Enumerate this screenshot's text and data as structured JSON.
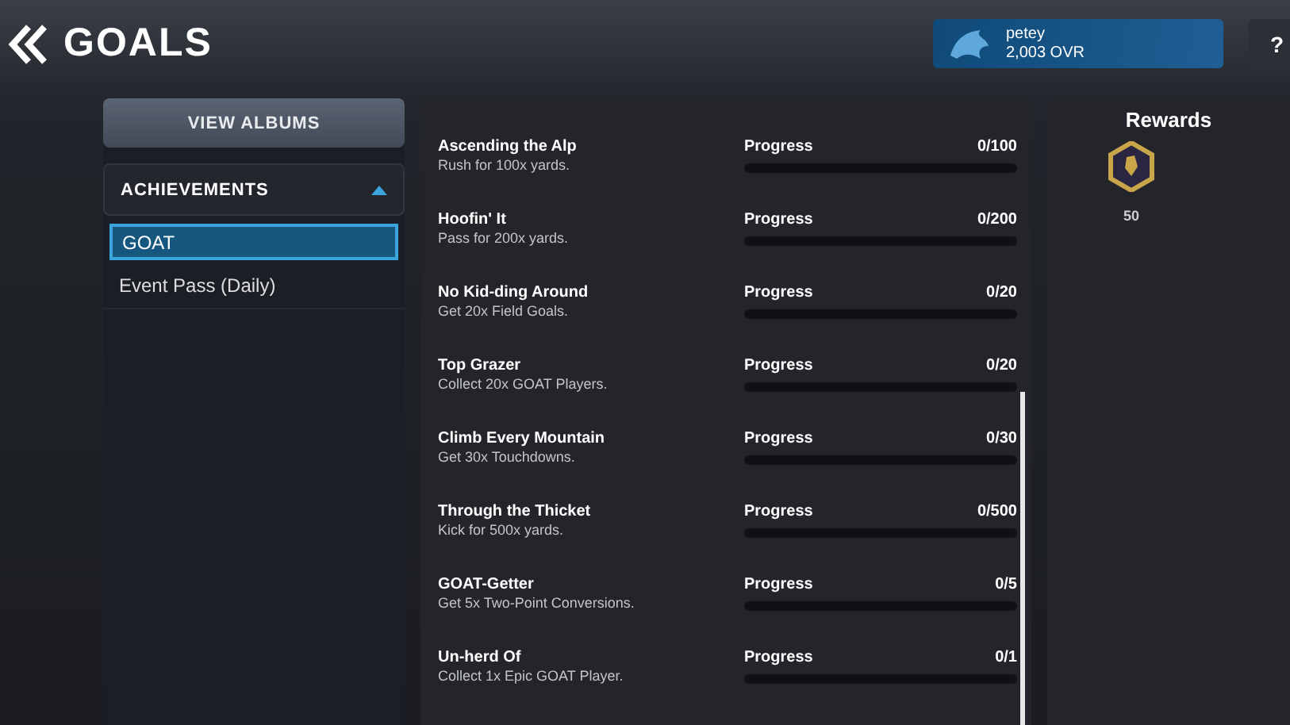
{
  "header": {
    "title": "GOALS",
    "profile": {
      "name": "petey",
      "rating": "2,003 OVR"
    },
    "help": "?"
  },
  "sidebar": {
    "view_albums": "VIEW ALBUMS",
    "section": {
      "label": "ACHIEVEMENTS",
      "expanded": true,
      "items": [
        {
          "label": "GOAT",
          "selected": true
        },
        {
          "label": "Event Pass (Daily)",
          "selected": false
        }
      ]
    }
  },
  "goals": [
    {
      "title": "Ascending the Alp",
      "description": "Rush for 100x yards.",
      "progress_label": "Progress",
      "count": "0/100",
      "level": 0
    },
    {
      "title": "Hoofin' It",
      "description": "Pass for 200x yards.",
      "progress_label": "Progress",
      "count": "0/200",
      "level": 0
    },
    {
      "title": "No Kid-ding Around",
      "description": "Get 20x Field Goals.",
      "progress_label": "Progress",
      "count": "0/20",
      "level": 0
    },
    {
      "title": "Top Grazer",
      "description": "Collect 20x GOAT Players.",
      "progress_label": "Progress",
      "count": "0/20",
      "level": 0
    },
    {
      "title": "Climb Every Mountain",
      "description": "Get 30x Touchdowns.",
      "progress_label": "Progress",
      "count": "0/30",
      "level": 0
    },
    {
      "title": "Through the Thicket",
      "description": "Kick for 500x yards.",
      "progress_label": "Progress",
      "count": "0/500",
      "level": 0
    },
    {
      "title": "GOAT-Getter",
      "description": "Get 5x Two-Point Conversions.",
      "progress_label": "Progress",
      "count": "0/5",
      "level": 0
    },
    {
      "title": "Un-herd Of",
      "description": "Collect 1x Epic GOAT Player.",
      "progress_label": "Progress",
      "count": "0/1",
      "level": 0
    }
  ],
  "rewards": {
    "title": "Rewards",
    "items": [
      {
        "amount": "50"
      }
    ]
  }
}
